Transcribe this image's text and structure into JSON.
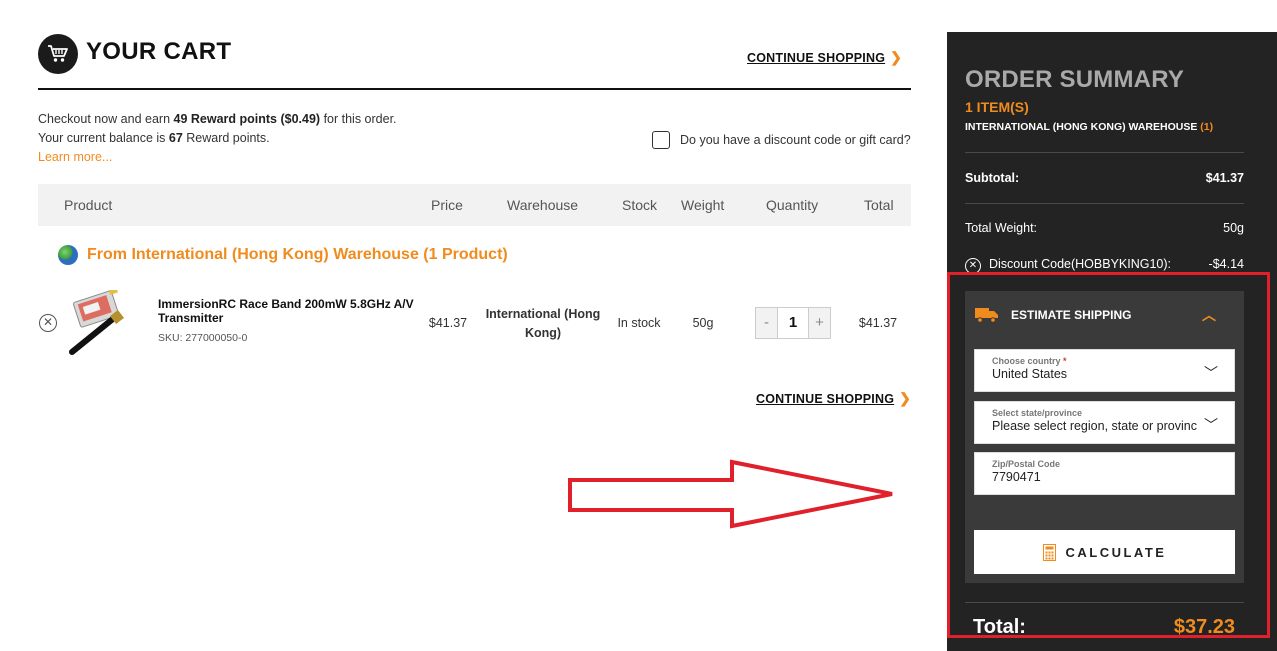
{
  "cart": {
    "title": "YOUR CART",
    "continue_label": "CONTINUE SHOPPING",
    "rewards": {
      "line1_pre": "Checkout now and earn ",
      "line1_points": "49 Reward points ($0.49)",
      "line1_post": " for this order.",
      "line2_pre": "Your current balance is ",
      "line2_points": "67",
      "line2_post": " Reward points.",
      "learn_more": "Learn more..."
    },
    "discount_question": "Do you have a discount code or gift card?",
    "columns": [
      "Product",
      "Price",
      "Warehouse",
      "Stock",
      "Weight",
      "Quantity",
      "Total"
    ],
    "warehouse_heading": "From International (Hong Kong) Warehouse (1 Product)",
    "item": {
      "name": "ImmersionRC Race Band 200mW 5.8GHz A/V Transmitter",
      "sku": "SKU: 277000050-0",
      "price": "$41.37",
      "warehouse": "International (Hong Kong)",
      "stock": "In stock",
      "weight": "50g",
      "quantity": "1",
      "total": "$41.37"
    }
  },
  "summary": {
    "title": "ORDER SUMMARY",
    "items": "1 ITEM(S)",
    "warehouse": "INTERNATIONAL (HONG KONG) WAREHOUSE",
    "warehouse_count": "(1)",
    "subtotal_label": "Subtotal:",
    "subtotal_value": "$41.37",
    "weight_label": "Total Weight:",
    "weight_value": "50g",
    "discount_label": "Discount Code(HOBBYKING10):",
    "discount_value": "-$4.14",
    "estimate_label": "ESTIMATE SHIPPING",
    "country_label": "Choose country",
    "country_value": "United States",
    "state_label": "Select state/province",
    "state_value": "Please select region, state or province",
    "zip_label": "Zip/Postal Code",
    "zip_value": "7790471",
    "calculate_label": "CALCULATE",
    "total_label": "Total:",
    "total_value": "$37.23"
  },
  "colors": {
    "accent": "#f08c1e",
    "summary_bg": "#232323",
    "highlight": "#e0202a"
  },
  "icons": [
    "cart-icon",
    "chevron-right-icon",
    "globe-icon",
    "remove-icon",
    "truck-icon",
    "chevron-up-icon",
    "chevron-down-icon",
    "calculator-icon",
    "arrow-annotation"
  ]
}
